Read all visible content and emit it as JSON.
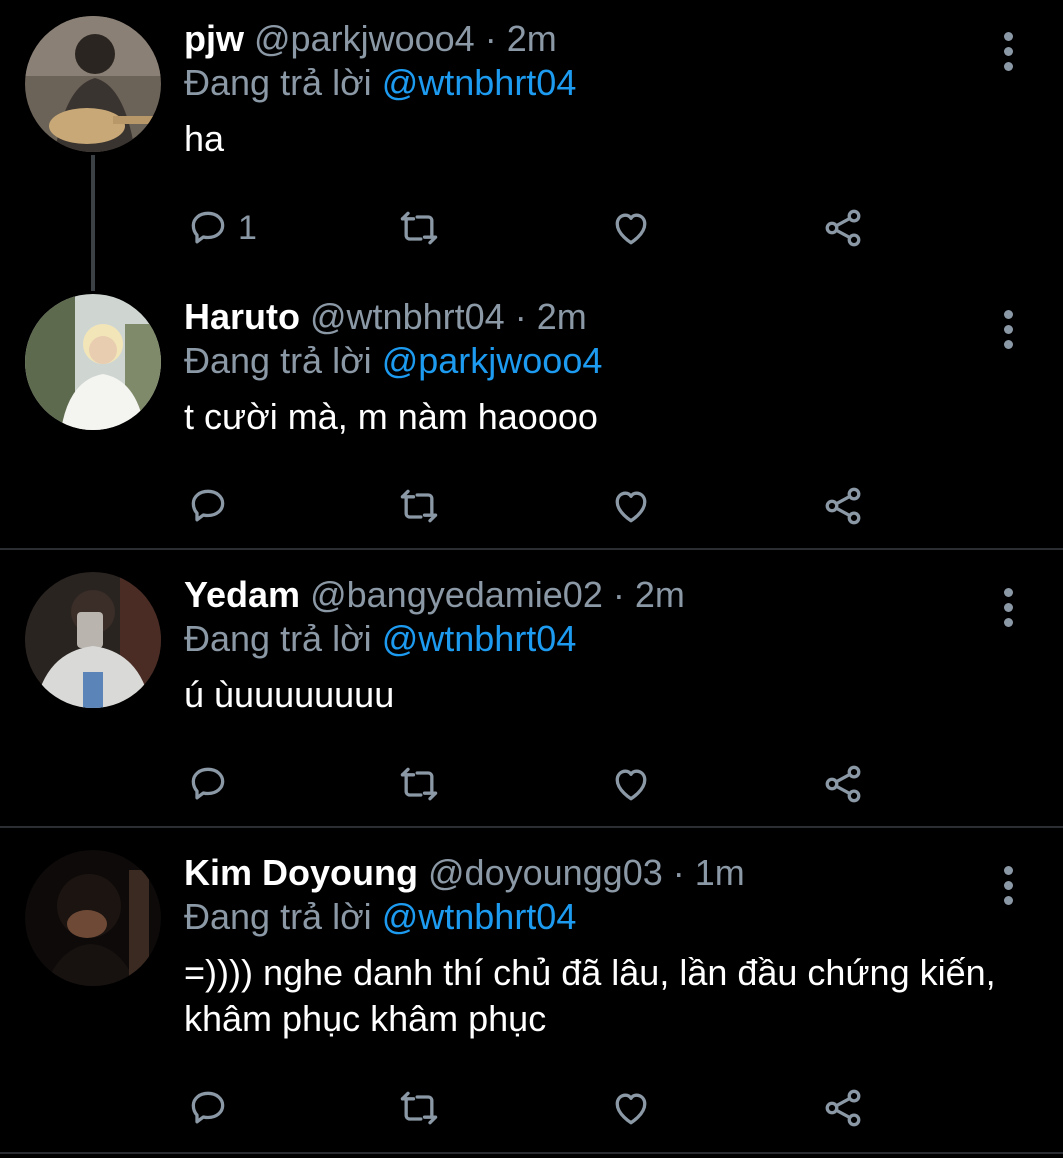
{
  "replying_label": "Đang trả lời",
  "tweets": [
    {
      "name": "pjw",
      "handle": "@parkjwooo4",
      "dot": "·",
      "time": "2m",
      "replying_to": "@wtnbhrt04",
      "text": "ha",
      "reply_count": "1",
      "avatar": "avatar-guitar"
    },
    {
      "name": "Haruto",
      "handle": "@wtnbhrt04",
      "dot": "·",
      "time": "2m",
      "replying_to": "@parkjwooo4",
      "text": "t cười mà, m nàm haoooo",
      "reply_count": "",
      "avatar": "avatar-blond"
    },
    {
      "name": "Yedam",
      "handle": "@bangyedamie02",
      "dot": "·",
      "time": "2m",
      "replying_to": "@wtnbhrt04",
      "text": "ú ùuuuuuuuu",
      "reply_count": "",
      "avatar": "avatar-mirror-selfie"
    },
    {
      "name": "Kim Doyoung",
      "handle": "@doyoungg03",
      "dot": "·",
      "time": "1m",
      "replying_to": "@wtnbhrt04",
      "text": "=)))) nghe danh thí chủ đã lâu, lần đầu chứng kiến, khâm phục khâm phục",
      "reply_count": "",
      "avatar": "avatar-dark-portrait"
    }
  ],
  "icons": {
    "reply": "speech-bubble-icon",
    "retweet": "retweet-icon",
    "like": "heart-icon",
    "share": "share-icon",
    "more": "more-vertical-icon"
  },
  "colors": {
    "background": "#000000",
    "name": "#ffffff",
    "secondary": "#8b98a5",
    "mention": "#1d9bf0",
    "divider": "#2a2e33"
  }
}
